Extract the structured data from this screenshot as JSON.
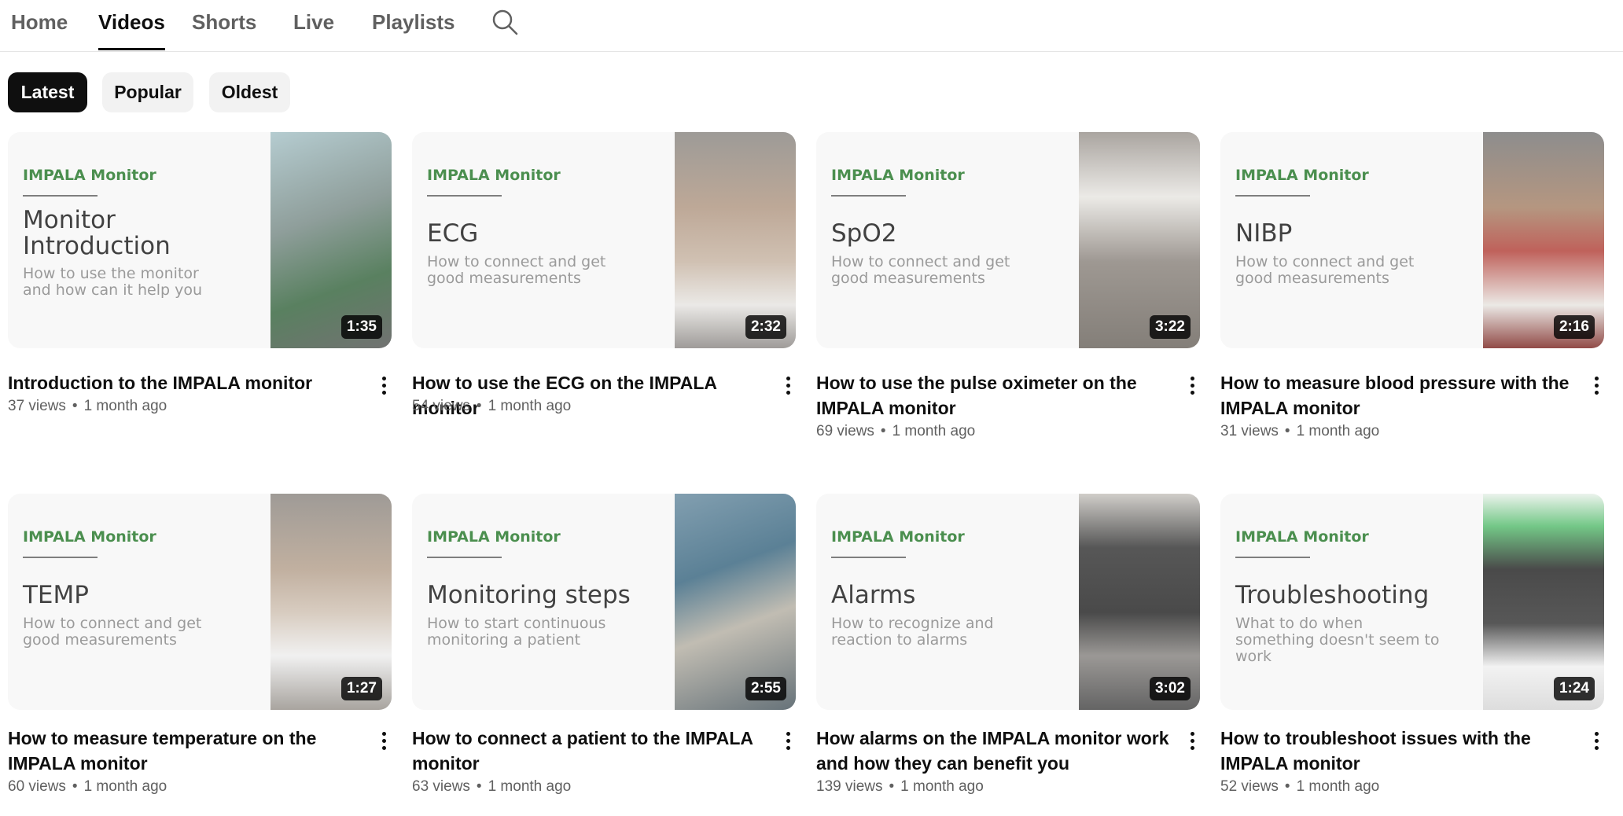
{
  "tabs": [
    {
      "label": "Home",
      "active": false
    },
    {
      "label": "Videos",
      "active": true
    },
    {
      "label": "Shorts",
      "active": false
    },
    {
      "label": "Live",
      "active": false
    },
    {
      "label": "Playlists",
      "active": false
    }
  ],
  "filters": [
    {
      "label": "Latest",
      "active": true
    },
    {
      "label": "Popular",
      "active": false
    },
    {
      "label": "Oldest",
      "active": false
    }
  ],
  "videos": [
    {
      "brand": "IMPALA Monitor",
      "topic": "Monitor Introduction",
      "subtitle": "How to use the monitor and how can it help you",
      "duration": "1:35",
      "title": "Introduction to the IMPALA monitor",
      "views": "37 views",
      "age": "1 month ago"
    },
    {
      "brand": "IMPALA Monitor",
      "topic": "ECG",
      "subtitle": "How to connect and get good measurements",
      "duration": "2:32",
      "title": "How to use the ECG on the IMPALA monitor",
      "views": "54 views",
      "age": "1 month ago"
    },
    {
      "brand": "IMPALA Monitor",
      "topic": "SpO2",
      "subtitle": "How to connect and get good measurements",
      "duration": "3:22",
      "title": "How to use the pulse oximeter on the IMPALA monitor",
      "views": "69 views",
      "age": "1 month ago"
    },
    {
      "brand": "IMPALA Monitor",
      "topic": "NIBP",
      "subtitle": "How to connect and get good measurements",
      "duration": "2:16",
      "title": "How to measure blood pressure with the IMPALA monitor",
      "views": "31 views",
      "age": "1 month ago"
    },
    {
      "brand": "IMPALA Monitor",
      "topic": "TEMP",
      "subtitle": "How to connect and get good measurements",
      "duration": "1:27",
      "title": "How to measure temperature on the IMPALA monitor",
      "views": "60 views",
      "age": "1 month ago"
    },
    {
      "brand": "IMPALA Monitor",
      "topic": "Monitoring steps",
      "subtitle": "How to start continuous monitoring a patient",
      "duration": "2:55",
      "title": "How to connect a patient to the IMPALA monitor",
      "views": "63 views",
      "age": "1 month ago"
    },
    {
      "brand": "IMPALA Monitor",
      "topic": "Alarms",
      "subtitle": "How to recognize and reaction to alarms",
      "duration": "3:02",
      "title": "How alarms on the IMPALA monitor work and how they can benefit you",
      "views": "139 views",
      "age": "1 month ago"
    },
    {
      "brand": "IMPALA Monitor",
      "topic": "Troubleshooting",
      "subtitle": "What to do when something doesn't seem to work",
      "duration": "1:24",
      "title": "How to troubleshoot issues with the IMPALA monitor",
      "views": "52 views",
      "age": "1 month ago"
    }
  ]
}
